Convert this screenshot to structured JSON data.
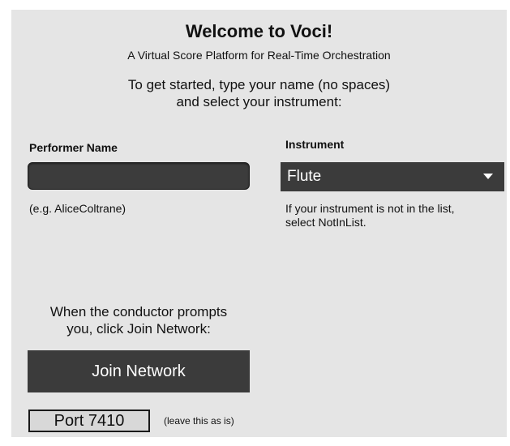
{
  "header": {
    "title": "Welcome to Voci!",
    "subtitle": "A Virtual Score Platform for Real-Time Orchestration",
    "instructions_line1": "To get started, type your name (no spaces)",
    "instructions_line2": "and select your instrument:"
  },
  "performer": {
    "label": "Performer Name",
    "value": "",
    "example": "(e.g. AliceColtrane)"
  },
  "instrument": {
    "label": "Instrument",
    "selected": "Flute",
    "note_line1": "If your instrument is not in the list,",
    "note_line2": "select NotInList."
  },
  "join": {
    "prompt_line1": "When the conductor prompts",
    "prompt_line2": "you, click Join Network:",
    "button_label": "Join Network"
  },
  "port": {
    "value": "Port 7410",
    "hint": "(leave this as is)"
  },
  "colors": {
    "panel_background": "#e5e5e5",
    "control_dark": "#3b3b3b",
    "control_text": "#ffffff"
  }
}
